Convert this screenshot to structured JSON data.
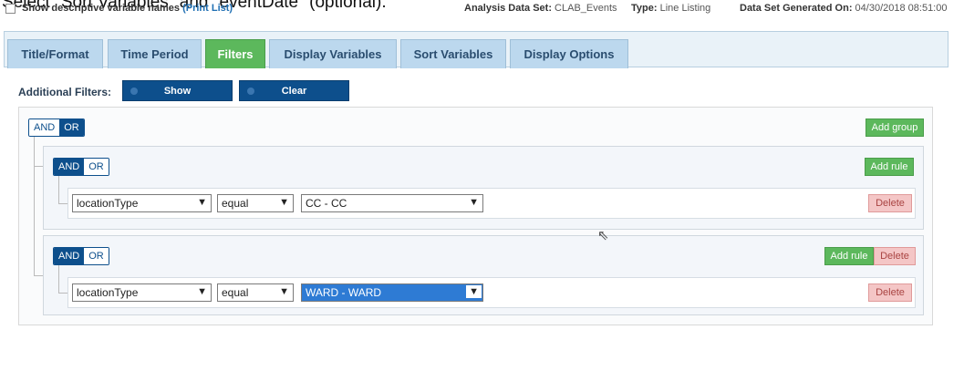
{
  "caption": "Select \"Sort Variables\" and \"eventDate\" (optional).",
  "topbar": {
    "show_descriptive": "Show descriptive variable names",
    "print_list": "(Print List)",
    "analysis_label": "Analysis Data Set:",
    "analysis_value": "CLAB_Events",
    "type_label": "Type:",
    "type_value": "Line Listing",
    "generated_label": "Data Set Generated On:",
    "generated_value": "04/30/2018 08:51:00"
  },
  "tabs": [
    {
      "label": "Title/Format"
    },
    {
      "label": "Time Period"
    },
    {
      "label": "Filters"
    },
    {
      "label": "Display Variables"
    },
    {
      "label": "Sort Variables"
    },
    {
      "label": "Display Options"
    }
  ],
  "active_tab": "Filters",
  "filters": {
    "label": "Additional Filters:",
    "show": "Show",
    "clear": "Clear"
  },
  "builder": {
    "and": "AND",
    "or": "OR",
    "add_group": "Add group",
    "add_rule": "Add rule",
    "delete": "Delete",
    "groups": [
      {
        "rules": [
          {
            "field": "locationType",
            "operator": "equal",
            "value": "CC - CC"
          }
        ]
      },
      {
        "rules": [
          {
            "field": "locationType",
            "operator": "equal",
            "value": "WARD - WARD"
          }
        ]
      }
    ]
  },
  "colors": {
    "active_tab": "#5cb85c",
    "primary": "#0d4f8c",
    "danger_bg": "#f4c6c6"
  }
}
